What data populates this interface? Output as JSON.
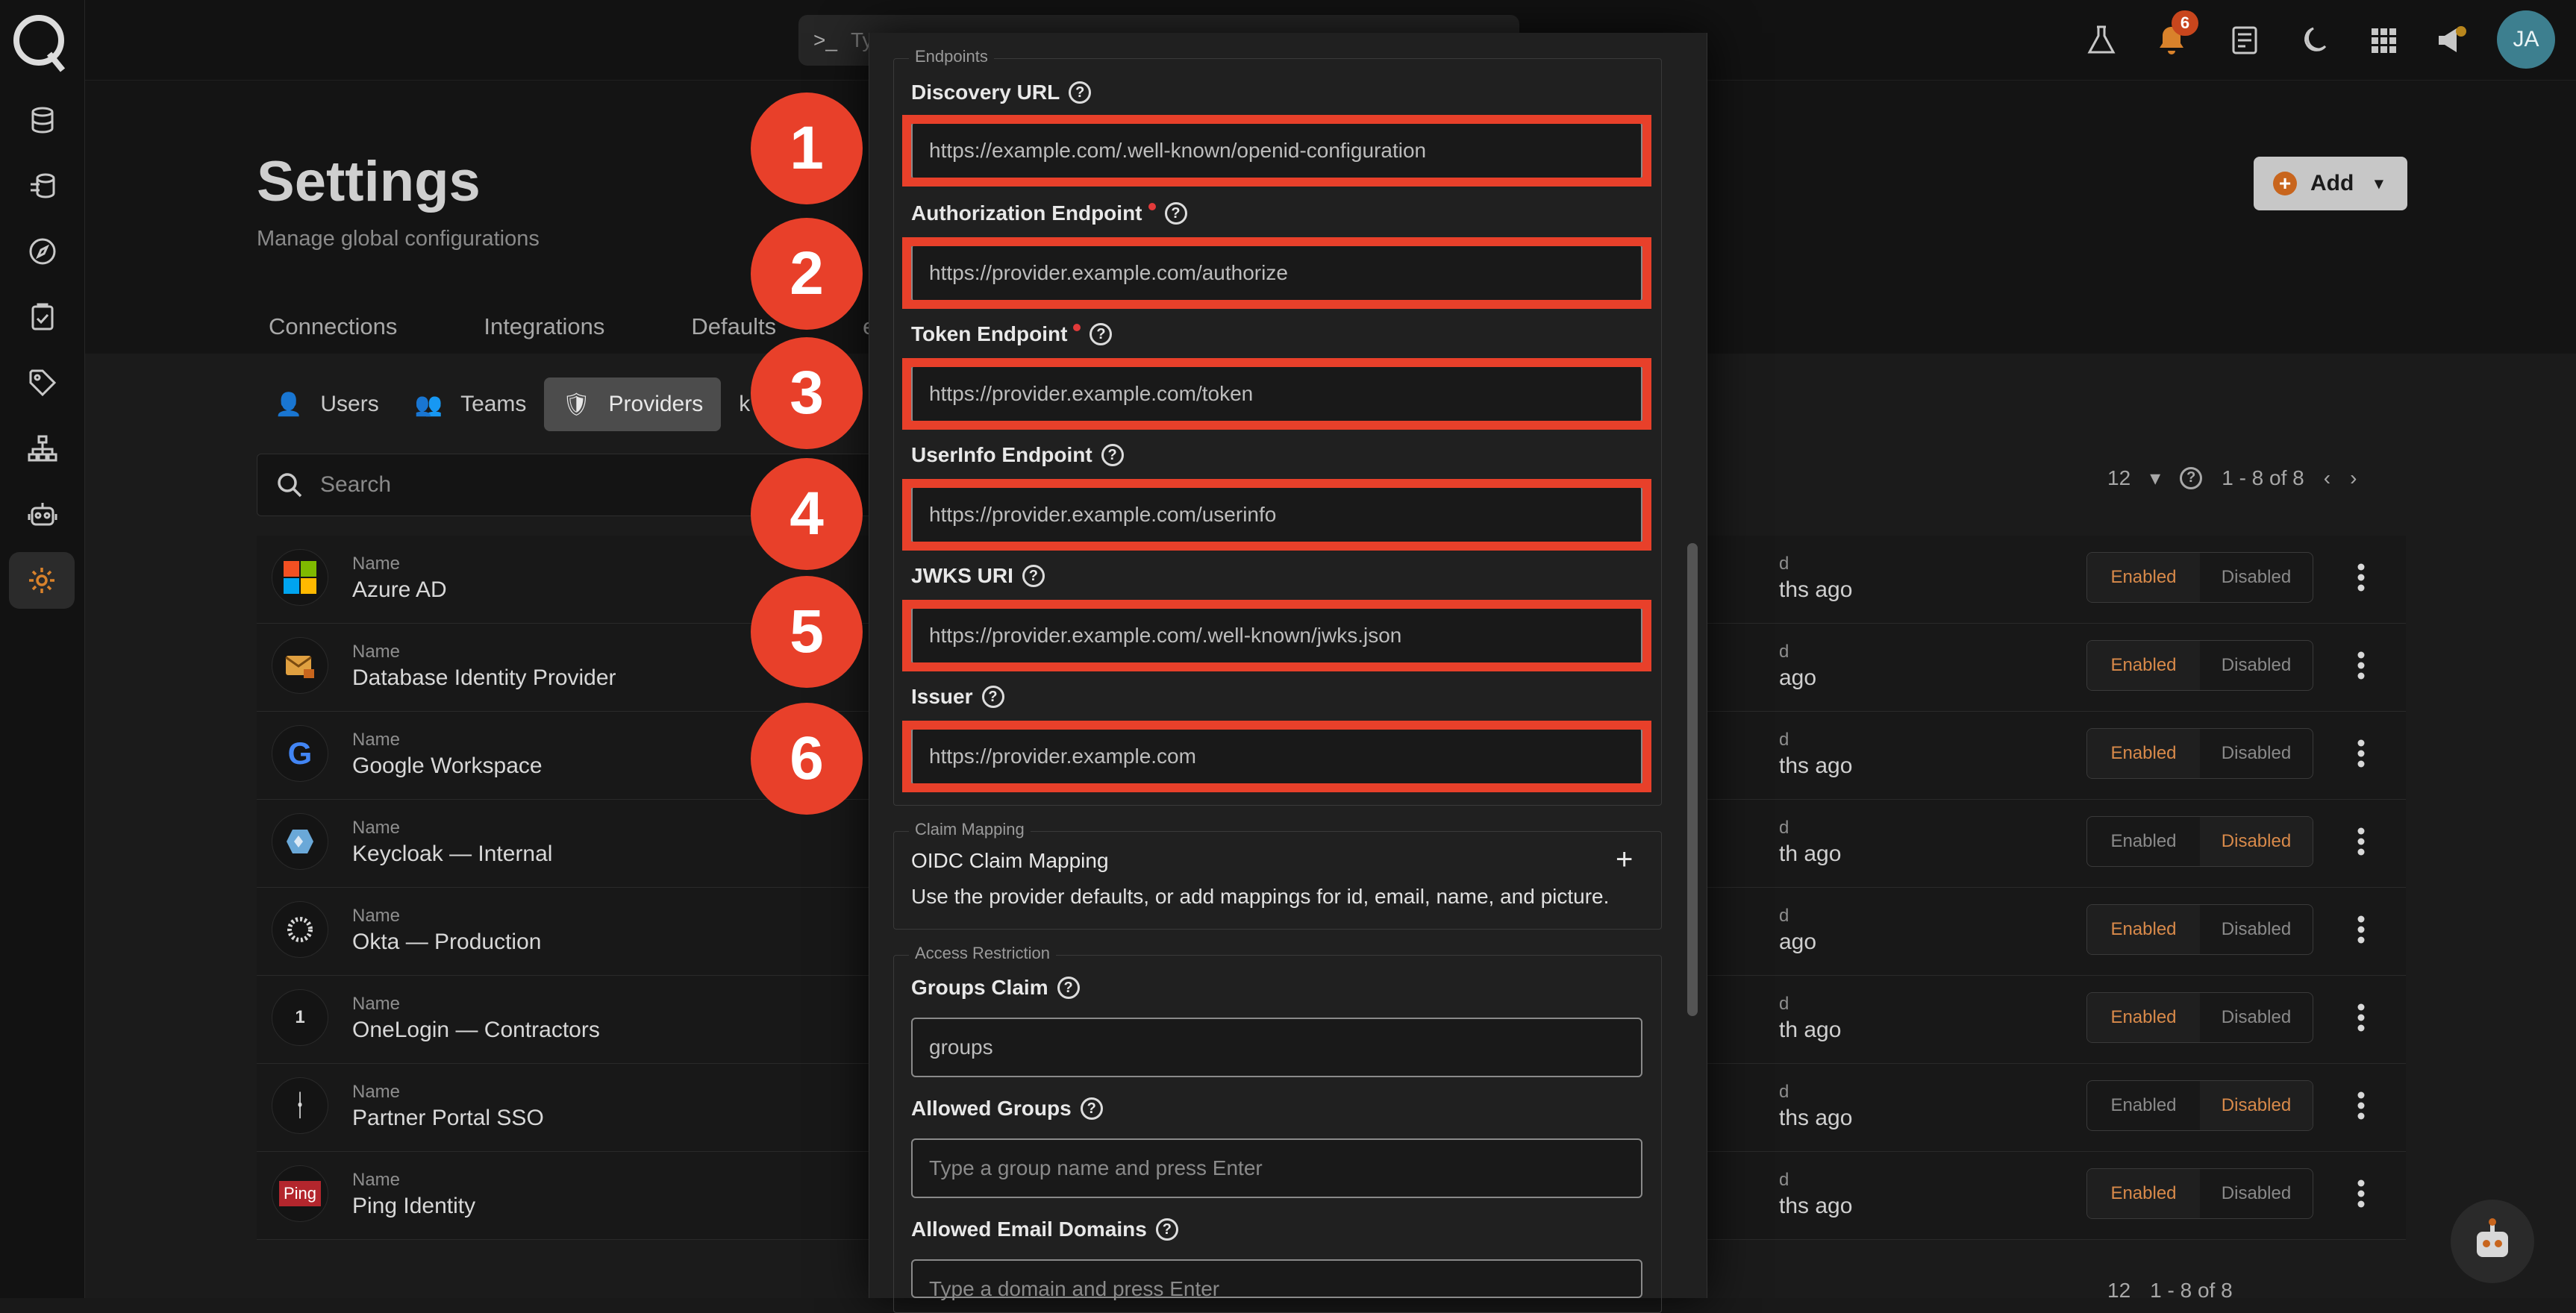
{
  "topbar": {
    "command_placeholder": "Type a comm",
    "notification_count": "6",
    "avatar_initials": "JA"
  },
  "header": {
    "title": "Settings",
    "subtitle": "Manage global configurations",
    "add_label": "Add",
    "tabs": [
      "Connections",
      "Integrations",
      "Defaults",
      "ess"
    ]
  },
  "subtabs": [
    "Users",
    "Teams",
    "Providers",
    "k"
  ],
  "search": {
    "placeholder": "Search",
    "partial": "S"
  },
  "pager": {
    "page_size": "12",
    "range": "1 - 8 of 8"
  },
  "pager_bottom": {
    "page_size": "12",
    "range": "1 - 8 of 8"
  },
  "table": {
    "name_label": "Name",
    "updated_label_fragment": "d",
    "enabled_label": "Enabled",
    "disabled_label": "Disabled",
    "rows": [
      {
        "name": "Azure AD",
        "updated": "ths ago",
        "state": "enabled"
      },
      {
        "name": "Database Identity Provider",
        "updated": "ago",
        "state": "enabled"
      },
      {
        "name": "Google Workspace",
        "updated": "ths ago",
        "state": "enabled"
      },
      {
        "name": "Keycloak — Internal",
        "updated": "th ago",
        "state": "disabled"
      },
      {
        "name": "Okta — Production",
        "updated": "ago",
        "state": "enabled"
      },
      {
        "name": "OneLogin — Contractors",
        "updated": "th ago",
        "state": "enabled"
      },
      {
        "name": "Partner Portal SSO",
        "updated": "ths ago",
        "state": "disabled"
      },
      {
        "name": "Ping Identity",
        "updated": "ths ago",
        "state": "enabled"
      }
    ]
  },
  "modal": {
    "endpoints_legend": "Endpoints",
    "discovery_label": "Discovery URL",
    "discovery_value": "https://example.com/.well-known/openid-configuration",
    "authorization_label": "Authorization Endpoint",
    "authorization_value": "https://provider.example.com/authorize",
    "token_label": "Token Endpoint",
    "token_value": "https://provider.example.com/token",
    "userinfo_label": "UserInfo Endpoint",
    "userinfo_value": "https://provider.example.com/userinfo",
    "jwks_label": "JWKS URI",
    "jwks_value": "https://provider.example.com/.well-known/jwks.json",
    "issuer_label": "Issuer",
    "issuer_value": "https://provider.example.com",
    "claim_legend": "Claim Mapping",
    "claim_title": "OIDC Claim Mapping",
    "claim_desc": "Use the provider defaults, or add mappings for id, email, name, and picture.",
    "access_legend": "Access Restriction",
    "groups_claim_label": "Groups Claim",
    "groups_claim_value": "groups",
    "allowed_groups_label": "Allowed Groups",
    "allowed_groups_placeholder": "Type a group name and press Enter",
    "allowed_domains_label": "Allowed Email Domains",
    "allowed_domains_placeholder": "Type a domain and press Enter"
  },
  "markers": [
    "1",
    "2",
    "3",
    "4",
    "5",
    "6"
  ],
  "colors": {
    "accent": "#d98a4a",
    "highlight": "#e8402a",
    "brand_orange": "#c8651d"
  }
}
